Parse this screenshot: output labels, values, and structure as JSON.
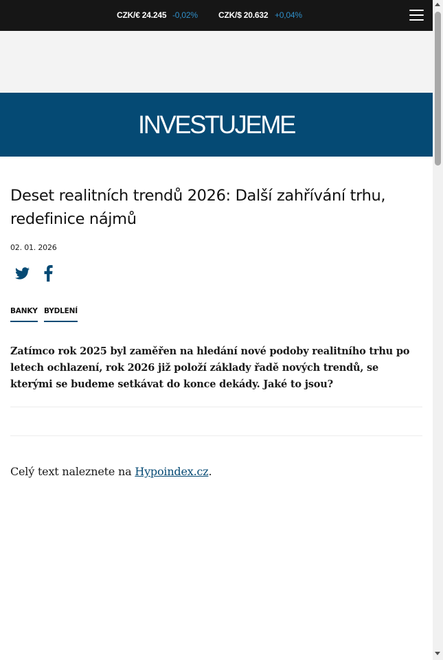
{
  "ticker": {
    "eur_label": "CZK/€ 24.245",
    "eur_change": "-0,02%",
    "usd_label": "CZK/$ 20.632",
    "usd_change": "+0,04%",
    "change_color": "#2f8fc9",
    "menu_icon": "hamburger-menu-icon"
  },
  "brand": {
    "logo_text": "INVESTUJEME",
    "banner_color": "#054a74"
  },
  "article": {
    "title": "Deset realitních trendů 2026: Další zahřívání trhu, redefinice nájmů",
    "date": "02. 01. 2026",
    "share": {
      "twitter_icon": "twitter-icon",
      "facebook_icon": "facebook-icon"
    },
    "tags": [
      "BANKY",
      "BYDLENÍ"
    ],
    "perex": "Zatímco rok 2025 byl zaměřen na hledání nové podoby realitního trhu po letech ochlazení, rok 2026 již položí základy řadě nových trendů, se kterými se budeme setkávat do konce dekády. Jaké to jsou?",
    "fulltext_prefix": "Celý text naleznete na ",
    "fulltext_link": "Hypoindex.cz",
    "fulltext_suffix": "."
  }
}
